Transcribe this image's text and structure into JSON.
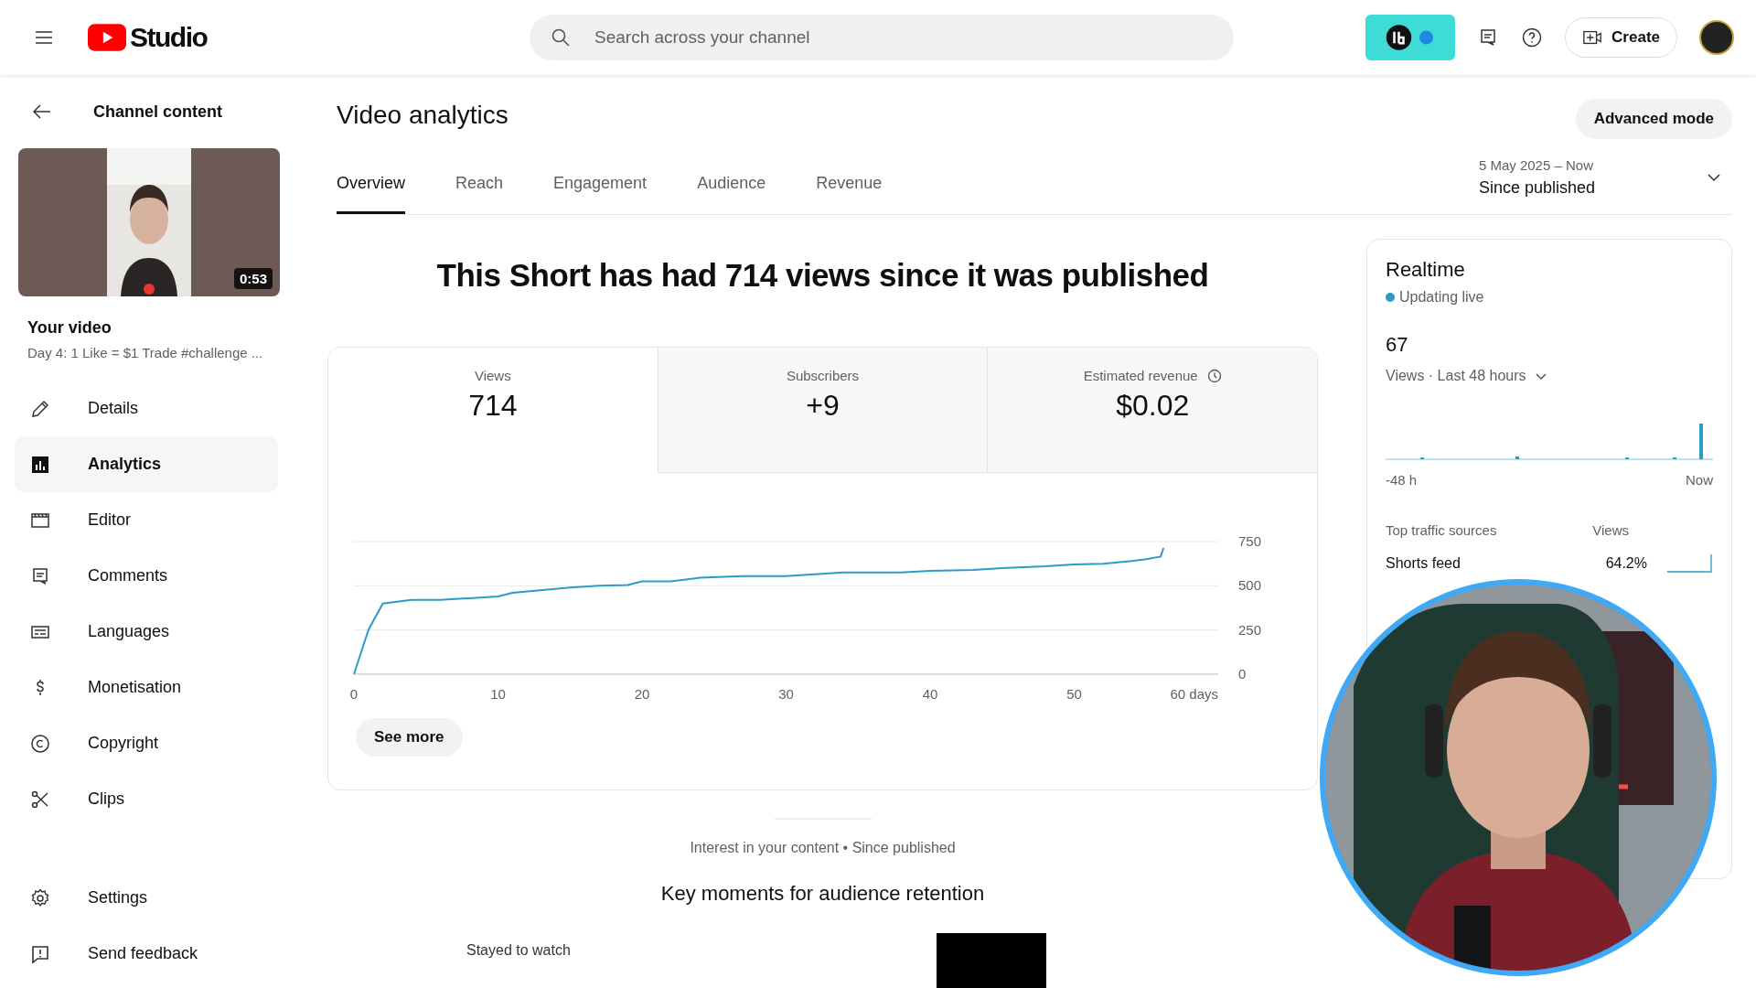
{
  "header": {
    "logo_text": "Studio",
    "search_placeholder": "Search across your channel",
    "create_label": "Create"
  },
  "sidebar": {
    "back_label": "Channel content",
    "video": {
      "duration": "0:53",
      "heading": "Your video",
      "title": "Day 4: 1 Like = $1 Trade #challenge ..."
    },
    "items": [
      {
        "label": "Details",
        "kind": "pencil",
        "selected": false
      },
      {
        "label": "Analytics",
        "kind": "chart",
        "selected": true
      },
      {
        "label": "Editor",
        "kind": "clapper",
        "selected": false
      },
      {
        "label": "Comments",
        "kind": "comment",
        "selected": false
      },
      {
        "label": "Languages",
        "kind": "subtitles",
        "selected": false
      },
      {
        "label": "Monetisation",
        "kind": "dollar",
        "selected": false
      },
      {
        "label": "Copyright",
        "kind": "copyright",
        "selected": false
      },
      {
        "label": "Clips",
        "kind": "scissors",
        "selected": false
      }
    ],
    "footer_items": [
      {
        "label": "Settings",
        "kind": "gear"
      },
      {
        "label": "Send feedback",
        "kind": "feedback"
      }
    ]
  },
  "main": {
    "title": "Video analytics",
    "advanced_button": "Advanced mode",
    "tabs": [
      {
        "label": "Overview",
        "selected": true
      },
      {
        "label": "Reach",
        "selected": false
      },
      {
        "label": "Engagement",
        "selected": false
      },
      {
        "label": "Audience",
        "selected": false
      },
      {
        "label": "Revenue",
        "selected": false
      }
    ],
    "date_range": {
      "range": "5 May 2025 – Now",
      "label": "Since published"
    },
    "headline": "This Short has had 714 views since it was published",
    "metrics": [
      {
        "label": "Views",
        "value": "714",
        "selected": true,
        "info": false
      },
      {
        "label": "Subscribers",
        "value": "+9",
        "selected": false,
        "info": false
      },
      {
        "label": "Estimated revenue",
        "value": "$0.02",
        "selected": false,
        "info": true
      }
    ],
    "chart_data": {
      "type": "line",
      "x": [
        0,
        1,
        2,
        4,
        6,
        8,
        10,
        11,
        15,
        17,
        19,
        20,
        22,
        24,
        27,
        30,
        34,
        38,
        40,
        43,
        45,
        48,
        50,
        52,
        54,
        55,
        56,
        56.2
      ],
      "series": [
        {
          "color": "#2d9cc4",
          "values": [
            0,
            250,
            400,
            420,
            420,
            430,
            440,
            460,
            490,
            500,
            505,
            525,
            525,
            545,
            555,
            555,
            575,
            575,
            585,
            590,
            600,
            610,
            620,
            625,
            640,
            650,
            665,
            714
          ]
        }
      ],
      "xlim": [
        0,
        60
      ],
      "ylim": [
        0,
        750
      ],
      "xticks": [
        0,
        10,
        20,
        30,
        40,
        50,
        {
          "value": 60,
          "label": "60 days"
        }
      ],
      "yticks": [
        0,
        250,
        500,
        750
      ]
    },
    "see_more": "See more",
    "caption": "Interest in your content • Since published",
    "section_title": "Key moments for audience retention",
    "retention_label": "Stayed to watch"
  },
  "realtime": {
    "title": "Realtime",
    "status": "Updating live",
    "count": "67",
    "metric": "Views · Last 48 hours",
    "axis_start": "-48 h",
    "axis_end": "Now",
    "traffic_heading": "Top traffic sources",
    "views_heading": "Views",
    "sources": [
      {
        "source": "Shorts feed",
        "share": "64.2%"
      }
    ]
  }
}
